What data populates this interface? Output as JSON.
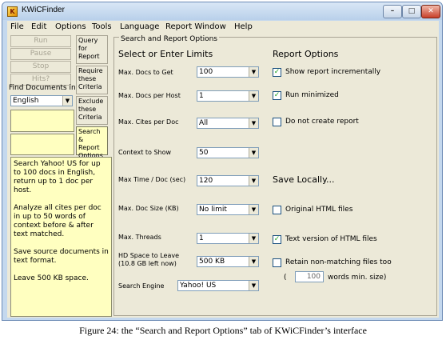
{
  "window": {
    "title": "KWiCFinder",
    "app_icon_glyph": "K",
    "min_glyph": "–",
    "max_glyph": "□",
    "close_glyph": "✕"
  },
  "menu": [
    "File",
    "Edit",
    "Options",
    "Tools",
    "Language",
    "Report Window",
    "Help"
  ],
  "left": {
    "buttons": [
      "Run",
      "Pause",
      "Stop",
      "Hits?"
    ],
    "find_label": "Find Documents in",
    "language": "English",
    "tabs": [
      "Query for Report",
      "Require these Criteria",
      "Exclude these Criteria",
      "Search & Report Options"
    ],
    "summary": [
      "Search Yahoo! US for up to 100 docs in English, return up to 1 doc per host.",
      "Analyze all cites per doc in up to 50 words of context before & after text matched.",
      "Save source documents in text format.",
      "Leave 500 KB space."
    ]
  },
  "panel": {
    "title": "Search and Report Options",
    "limits_heading": "Select or Enter Limits",
    "fields": [
      {
        "label": "Max. Docs to Get",
        "value": "100"
      },
      {
        "label": "Max. Docs per Host",
        "value": "1"
      },
      {
        "label": "Max. Cites per Doc",
        "value": "All"
      },
      {
        "label": "Context to Show",
        "value": "50"
      },
      {
        "label": "Max Time / Doc (sec)",
        "value": "120"
      },
      {
        "label": "Max. Doc Size (KB)",
        "value": "No limit"
      },
      {
        "label": "Max. Threads",
        "value": "1"
      },
      {
        "label": "HD Space to Leave (10.8 GB left now)",
        "value": "500 KB"
      }
    ],
    "search_engine_label": "Search Engine",
    "search_engine": "Yahoo! US",
    "report_heading": "Report Options",
    "report_options": [
      {
        "label": "Show report incrementally",
        "checked": true
      },
      {
        "label": "Run minimized",
        "checked": true
      },
      {
        "label": "Do not create report",
        "checked": false
      }
    ],
    "save_heading": "Save Locally...",
    "save_options": [
      {
        "label": "Original HTML files",
        "checked": false
      },
      {
        "label": "Text version of HTML files",
        "checked": true
      },
      {
        "label": "Retain non-matching files too",
        "checked": false
      }
    ],
    "min_size_open": "(",
    "min_size": "100",
    "min_size_label": "words min. size)"
  },
  "caption": "Figure 24: the “Search and Report Options” tab of KWiCFinder’s interface",
  "colors": {
    "note_yellow": "#ffffc0",
    "check_green": "#21a121",
    "dialog_face": "#ece9d8"
  }
}
